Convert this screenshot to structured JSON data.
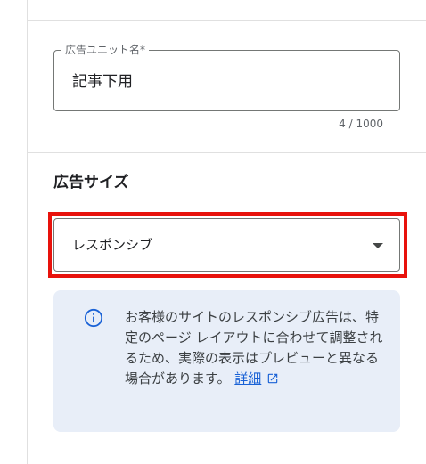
{
  "ad_unit_name": {
    "label": "広告ユニット名*",
    "value": "記事下用",
    "counter": "4 / 1000"
  },
  "ad_size": {
    "title": "広告サイズ",
    "selected": "レスポンシブ",
    "select_icon": "arrow-drop-down-icon"
  },
  "info": {
    "icon": "info-icon",
    "text": "お客様のサイトのレスポンシブ広告は、特定のページ レイアウトに合わせて調整されるため、実際の表示はプレビューと異なる場合があります。",
    "link_label": "詳細",
    "link_icon": "open-in-new-icon"
  },
  "colors": {
    "highlight": "#e8120c",
    "info_background": "#e8eef8",
    "link": "#1a62d6",
    "info_icon": "#1a62d6"
  }
}
